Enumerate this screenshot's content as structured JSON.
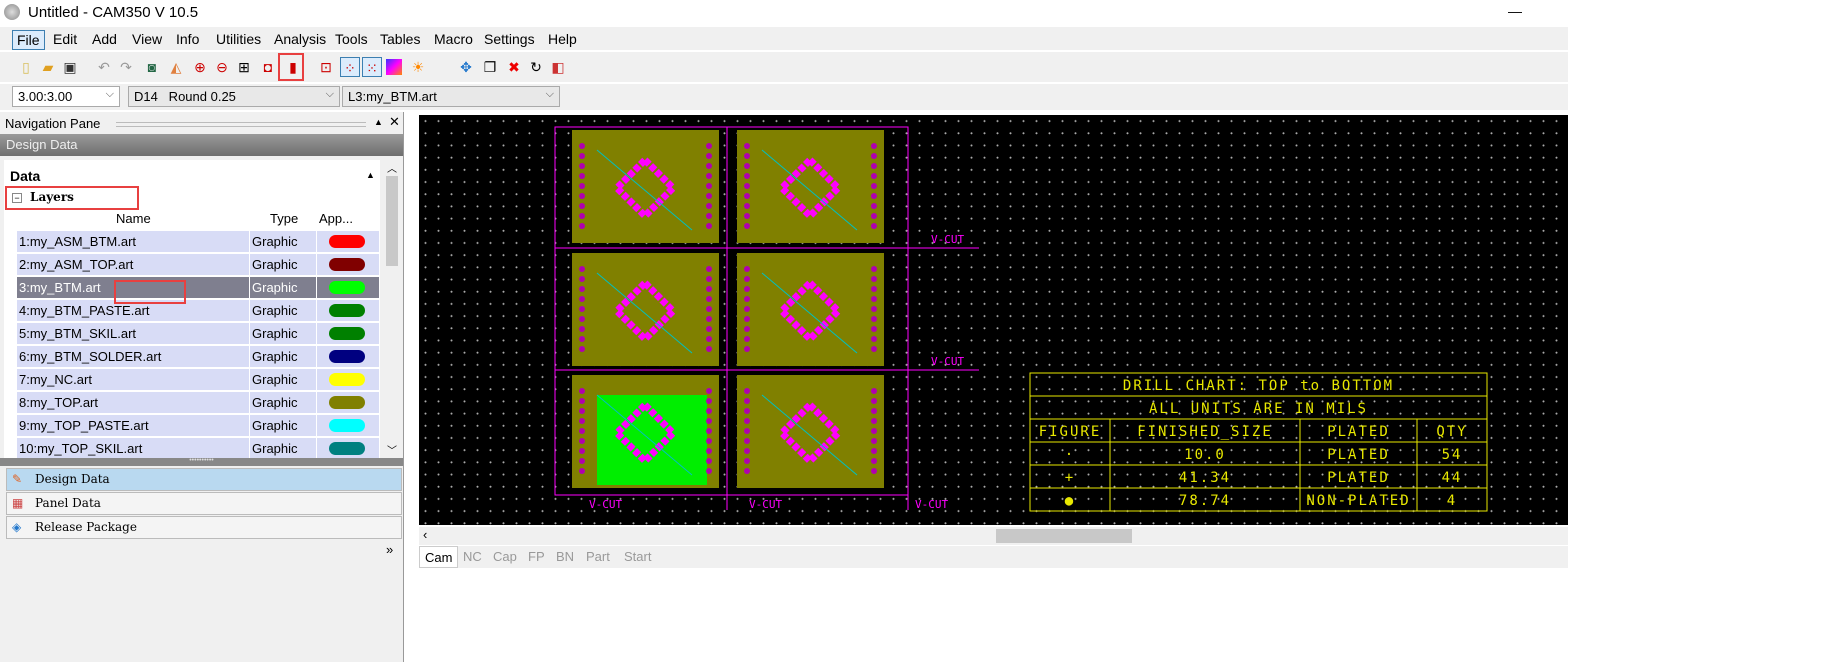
{
  "window": {
    "title": "Untitled - CAM350 V 10.5",
    "minimize": "—"
  },
  "menu": [
    "File",
    "Edit",
    "Add",
    "View",
    "Info",
    "Utilities",
    "Analysis",
    "Tools",
    "Tables",
    "Macro",
    "Settings",
    "Help"
  ],
  "toolbar": {
    "icons": [
      "new-file",
      "open-folder",
      "save",
      "undo",
      "redo",
      "query",
      "eraser",
      "zoom-in",
      "zoom-out",
      "zoom-window",
      "zoom-all",
      "redraw",
      "layer-flip",
      "snap-grid",
      "visible-grid",
      "layer-colors",
      "highlight",
      "move",
      "copy",
      "delete",
      "rotate",
      "mirror"
    ]
  },
  "combos": {
    "grid": "3.00:3.00",
    "dcode": "D14   Round 0.25",
    "layer": "L3:my_BTM.art"
  },
  "nav": {
    "title": "Navigation Pane",
    "pin": "▲",
    "close": "✕",
    "section": "Design Data",
    "data_label": "Data",
    "group": "Layers",
    "columns": {
      "name": "Name",
      "type": "Type",
      "appearance": "App..."
    },
    "layers": [
      {
        "name": "1:my_ASM_BTM.art",
        "type": "Graphic",
        "color": "#ff0000"
      },
      {
        "name": "2:my_ASM_TOP.art",
        "type": "Graphic",
        "color": "#800000"
      },
      {
        "name": "3:my_BTM.art",
        "type": "Graphic",
        "color": "#00ff00",
        "selected": true
      },
      {
        "name": "4:my_BTM_PASTE.art",
        "type": "Graphic",
        "color": "#008000"
      },
      {
        "name": "5:my_BTM_SKIL.art",
        "type": "Graphic",
        "color": "#008000"
      },
      {
        "name": "6:my_BTM_SOLDER.art",
        "type": "Graphic",
        "color": "#000080"
      },
      {
        "name": "7:my_NC.art",
        "type": "Graphic",
        "color": "#ffff00"
      },
      {
        "name": "8:my_TOP.art",
        "type": "Graphic",
        "color": "#808000"
      },
      {
        "name": "9:my_TOP_PASTE.art",
        "type": "Graphic",
        "color": "#00ffff"
      },
      {
        "name": "10:my_TOP_SKIL.art",
        "type": "Graphic",
        "color": "#008080"
      }
    ],
    "buttons": [
      "Design Data",
      "Panel Data",
      "Release Package"
    ],
    "more": "»"
  },
  "canvas": {
    "vcut": "V-CUT",
    "drill_chart": {
      "title": "DRILL CHART: TOP to BOTTOM",
      "subtitle": "ALL UNITS ARE IN MILS",
      "headers": [
        "FIGURE",
        "FINISHED_SIZE",
        "PLATED",
        "QTY"
      ],
      "rows": [
        [
          "·",
          "10.0",
          "PLATED",
          "54"
        ],
        [
          "+",
          "41.34",
          "PLATED",
          "44"
        ],
        [
          "●",
          "78.74",
          "NON-PLATED",
          "4"
        ]
      ]
    }
  },
  "bottom_tabs": [
    "Cam",
    "NC",
    "Cap",
    "FP",
    "BN",
    "Part",
    "Start"
  ]
}
